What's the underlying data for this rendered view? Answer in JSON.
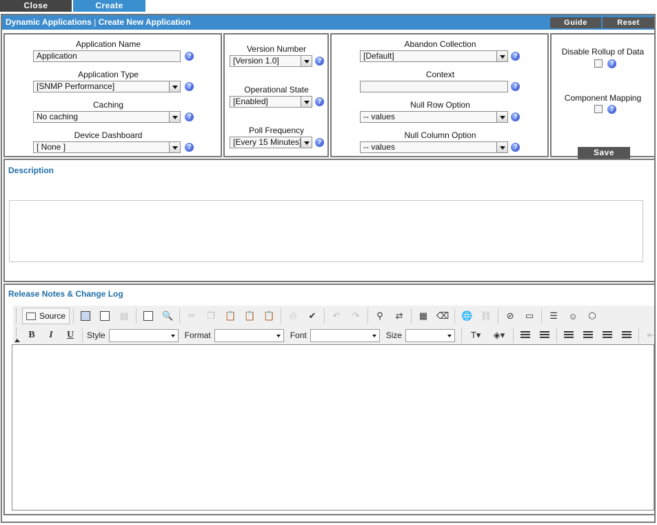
{
  "tabs": {
    "close": "Close",
    "create": "Create"
  },
  "header": {
    "section": "Dynamic Applications",
    "separator": "|",
    "title": "Create New Application",
    "guide": "Guide",
    "reset": "Reset"
  },
  "form": {
    "application_name": {
      "label": "Application Name",
      "value": "Application"
    },
    "application_type": {
      "label": "Application Type",
      "value": "[SNMP Performance]"
    },
    "caching": {
      "label": "Caching",
      "value": "No caching"
    },
    "device_dashboard": {
      "label": "Device Dashboard",
      "value": "[ None ]"
    },
    "version_number": {
      "label": "Version Number",
      "value": "[Version 1.0]"
    },
    "operational_state": {
      "label": "Operational State",
      "value": "[Enabled]"
    },
    "poll_frequency": {
      "label": "Poll Frequency",
      "value": "[Every 15 Minutes]"
    },
    "abandon_collection": {
      "label": "Abandon Collection",
      "value": "[Default]"
    },
    "context": {
      "label": "Context",
      "value": ""
    },
    "null_row_option": {
      "label": "Null Row Option",
      "value": "-- values"
    },
    "null_column_option": {
      "label": "Null Column Option",
      "value": "-- values"
    },
    "disable_rollup": {
      "label": "Disable Rollup of Data",
      "checked": false
    },
    "component_mapping": {
      "label": "Component Mapping",
      "checked": false
    },
    "save": "Save",
    "help_glyph": "?"
  },
  "description": {
    "title": "Description",
    "value": ""
  },
  "release_notes": {
    "title": "Release Notes & Change Log",
    "toolbar": {
      "source": "Source",
      "style": "Style",
      "format": "Format",
      "font": "Font",
      "size": "Size",
      "bold": "B",
      "italic": "I",
      "underline": "U"
    },
    "value": ""
  }
}
